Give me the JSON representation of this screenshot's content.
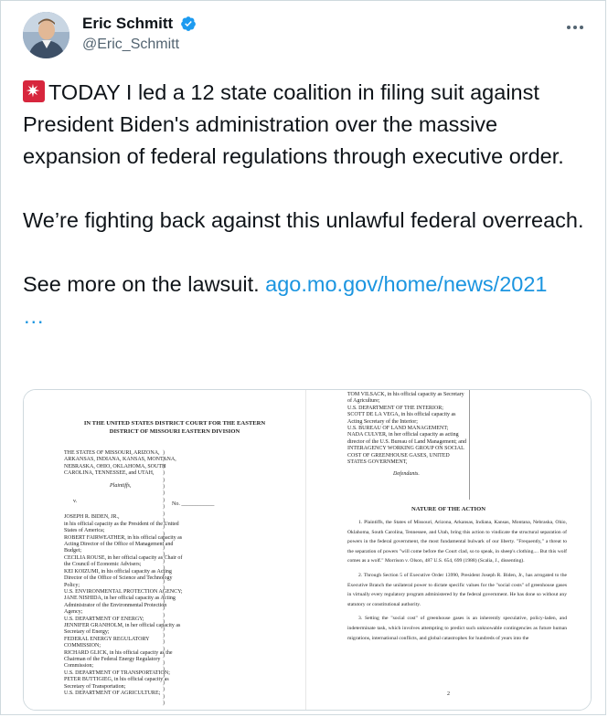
{
  "tweet": {
    "author": {
      "display_name": "Eric Schmitt",
      "handle": "@Eric_Schmitt",
      "verified": true
    },
    "icons": {
      "verified": "verified-badge-icon",
      "more": "more-options-icon",
      "emoji": "police-car-light-emoji"
    },
    "text": {
      "para1": "TODAY I led a 12 state coalition in filing suit against President Biden's administration over the massive expansion of federal regulations through executive order.",
      "para2": "We’re fighting back against this unlawful federal overreach.",
      "para3_prefix": "See more on the lawsuit. ",
      "link": "ago.mo.gov/home/news/2021",
      "ellipsis": "…"
    },
    "colors": {
      "link": "#1b95e0",
      "verified": "#1d9bf0",
      "handle": "#536471"
    }
  },
  "document": {
    "left_page": {
      "court_heading": "IN THE UNITED STATES DISTRICT COURT FOR THE EASTERN DISTRICT OF MISSOURI EASTERN DIVISION",
      "plaintiffs": "THE STATES OF MISSOURI, ARIZONA, ARKANSAS, INDIANA, KANSAS, MONTANA, NEBRASKA, OHIO, OKLAHOMA, SOUTH CAROLINA, TENNESSEE, and UTAH,",
      "plaintiffs_role": "Plaintiffs,",
      "versus": "v.",
      "case_no": "No. ____________",
      "defendants": [
        "JOSEPH R. BIDEN, JR.,",
        "in his official capacity as the President of the United States of America;",
        "ROBERT FAIRWEATHER, in his official capacity as Acting Director of the Office of Management and Budget;",
        "CECILIA ROUSE, in her official capacity as Chair of the Council of Economic Advisers;",
        "KEI KOIZUMI, in his official capacity as Acting Director of the Office of Science and Technology Policy;",
        "U.S. ENVIRONMENTAL PROTECTION AGENCY;",
        "JANE NISHIDA, in her official capacity as Acting Administrator of the Environmental Protection Agency;",
        "U.S. DEPARTMENT OF ENERGY;",
        "JENNIFER GRANHOLM, in her official capacity as Secretary of Energy;",
        "FEDERAL ENERGY REGULATORY COMMISSION;",
        "RICHARD GLICK, in his official capacity as the Chairman of the Federal Energy Regulatory Commission;",
        "U.S. DEPARTMENT OF TRANSPORTATION;",
        "PETER BUTTIGIEG, in his official capacity as Secretary of Transportation;",
        "U.S. DEPARTMENT OF AGRICULTURE;"
      ]
    },
    "right_page": {
      "defendants_cont": [
        "TOM VILSACK, in his official capacity as Secretary of Agriculture;",
        "U.S. DEPARTMENT OF THE INTERIOR;",
        "SCOTT DE LA VEGA, in his official capacity as Acting Secretary of the Interior;",
        "U.S. BUREAU OF LAND MANAGEMENT;",
        "NADA CULVER, in her official capacity as acting director of the U.S. Bureau of Land Management; and",
        "INTERAGENCY WORKING GROUP ON SOCIAL COST OF GREENHOUSE GASES, UNITED STATES GOVERNMENT,"
      ],
      "defendants_role": "Defendants.",
      "nature_title": "NATURE OF THE ACTION",
      "paragraphs": [
        "1. Plaintiffs, the States of Missouri, Arizona, Arkansas, Indiana, Kansas, Montana, Nebraska, Ohio, Oklahoma, South Carolina, Tennessee, and Utah, bring this action to vindicate the structural separation of powers in the federal government, the most fundamental bulwark of our liberty. \"Frequently,\" a threat to the separation of powers \"will come before the Court clad, so to speak, in sheep's clothing.... But this wolf comes as a wolf.\" Morrison v. Olson, 487 U.S. 654, 699 (1988) (Scalia, J., dissenting).",
        "2. Through Section 5 of Executive Order 13990, President Joseph R. Biden, Jr., has arrogated to the Executive Branch the unilateral power to dictate specific values for the \"social costs\" of greenhouse gases in virtually every regulatory program administered by the federal government. He has done so without any statutory or constitutional authority.",
        "3. Setting the \"social cost\" of greenhouse gases is an inherently speculative, policy-laden, and indeterminate task, which involves attempting to predict such unknowable contingencies as future human migrations, international conflicts, and global catastrophes for hundreds of years into the"
      ],
      "page_number": "2"
    }
  }
}
